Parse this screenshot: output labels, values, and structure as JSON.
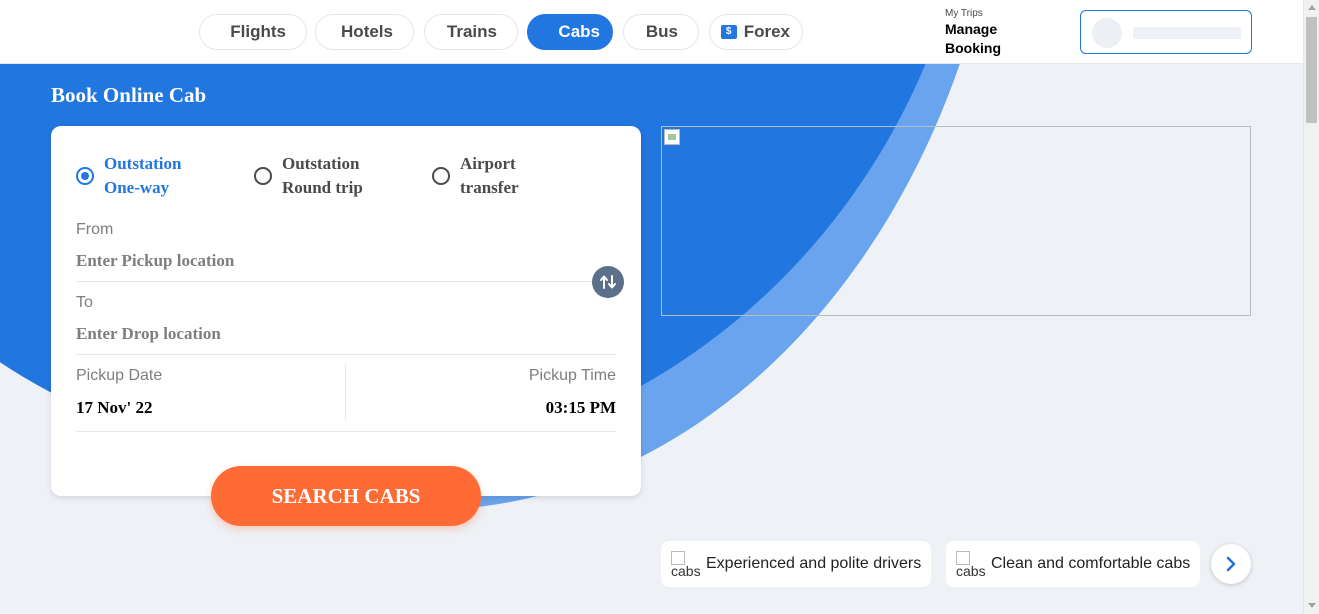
{
  "nav": {
    "tabs": [
      {
        "label": "Flights",
        "active": false
      },
      {
        "label": "Hotels",
        "active": false
      },
      {
        "label": "Trains",
        "active": false
      },
      {
        "label": "Cabs",
        "active": true
      },
      {
        "label": "Bus",
        "active": false
      },
      {
        "label": "Forex",
        "active": false,
        "icon": "dollar-note-icon"
      }
    ],
    "forex_icon_glyph": "$",
    "my_trips": {
      "small": "My Trips",
      "big": "Manage Booking"
    }
  },
  "page": {
    "title": "Book Online Cab"
  },
  "trip_types": [
    {
      "label": "Outstation One-way",
      "selected": true
    },
    {
      "label": "Outstation Round trip",
      "selected": false
    },
    {
      "label": "Airport transfer",
      "selected": false
    }
  ],
  "form": {
    "from_label": "From",
    "from_placeholder": "Enter Pickup location",
    "to_label": "To",
    "to_placeholder": "Enter Drop location",
    "pickup_date_label": "Pickup Date",
    "pickup_date": "17 Nov' 22",
    "pickup_time_label": "Pickup Time",
    "pickup_time": "03:15 PM",
    "search_label": "SEARCH CABS"
  },
  "features": [
    {
      "img_alt": "cabs",
      "text": "Experienced and polite drivers"
    },
    {
      "img_alt": "cabs",
      "text": "Clean and comfortable cabs"
    }
  ],
  "colors": {
    "brand_blue": "#2176e0",
    "cta_orange": "#ff6b35",
    "swap_button": "#5c7089"
  },
  "icons": {
    "swap": "swap-arrows-icon",
    "next": "chevron-right-icon"
  }
}
